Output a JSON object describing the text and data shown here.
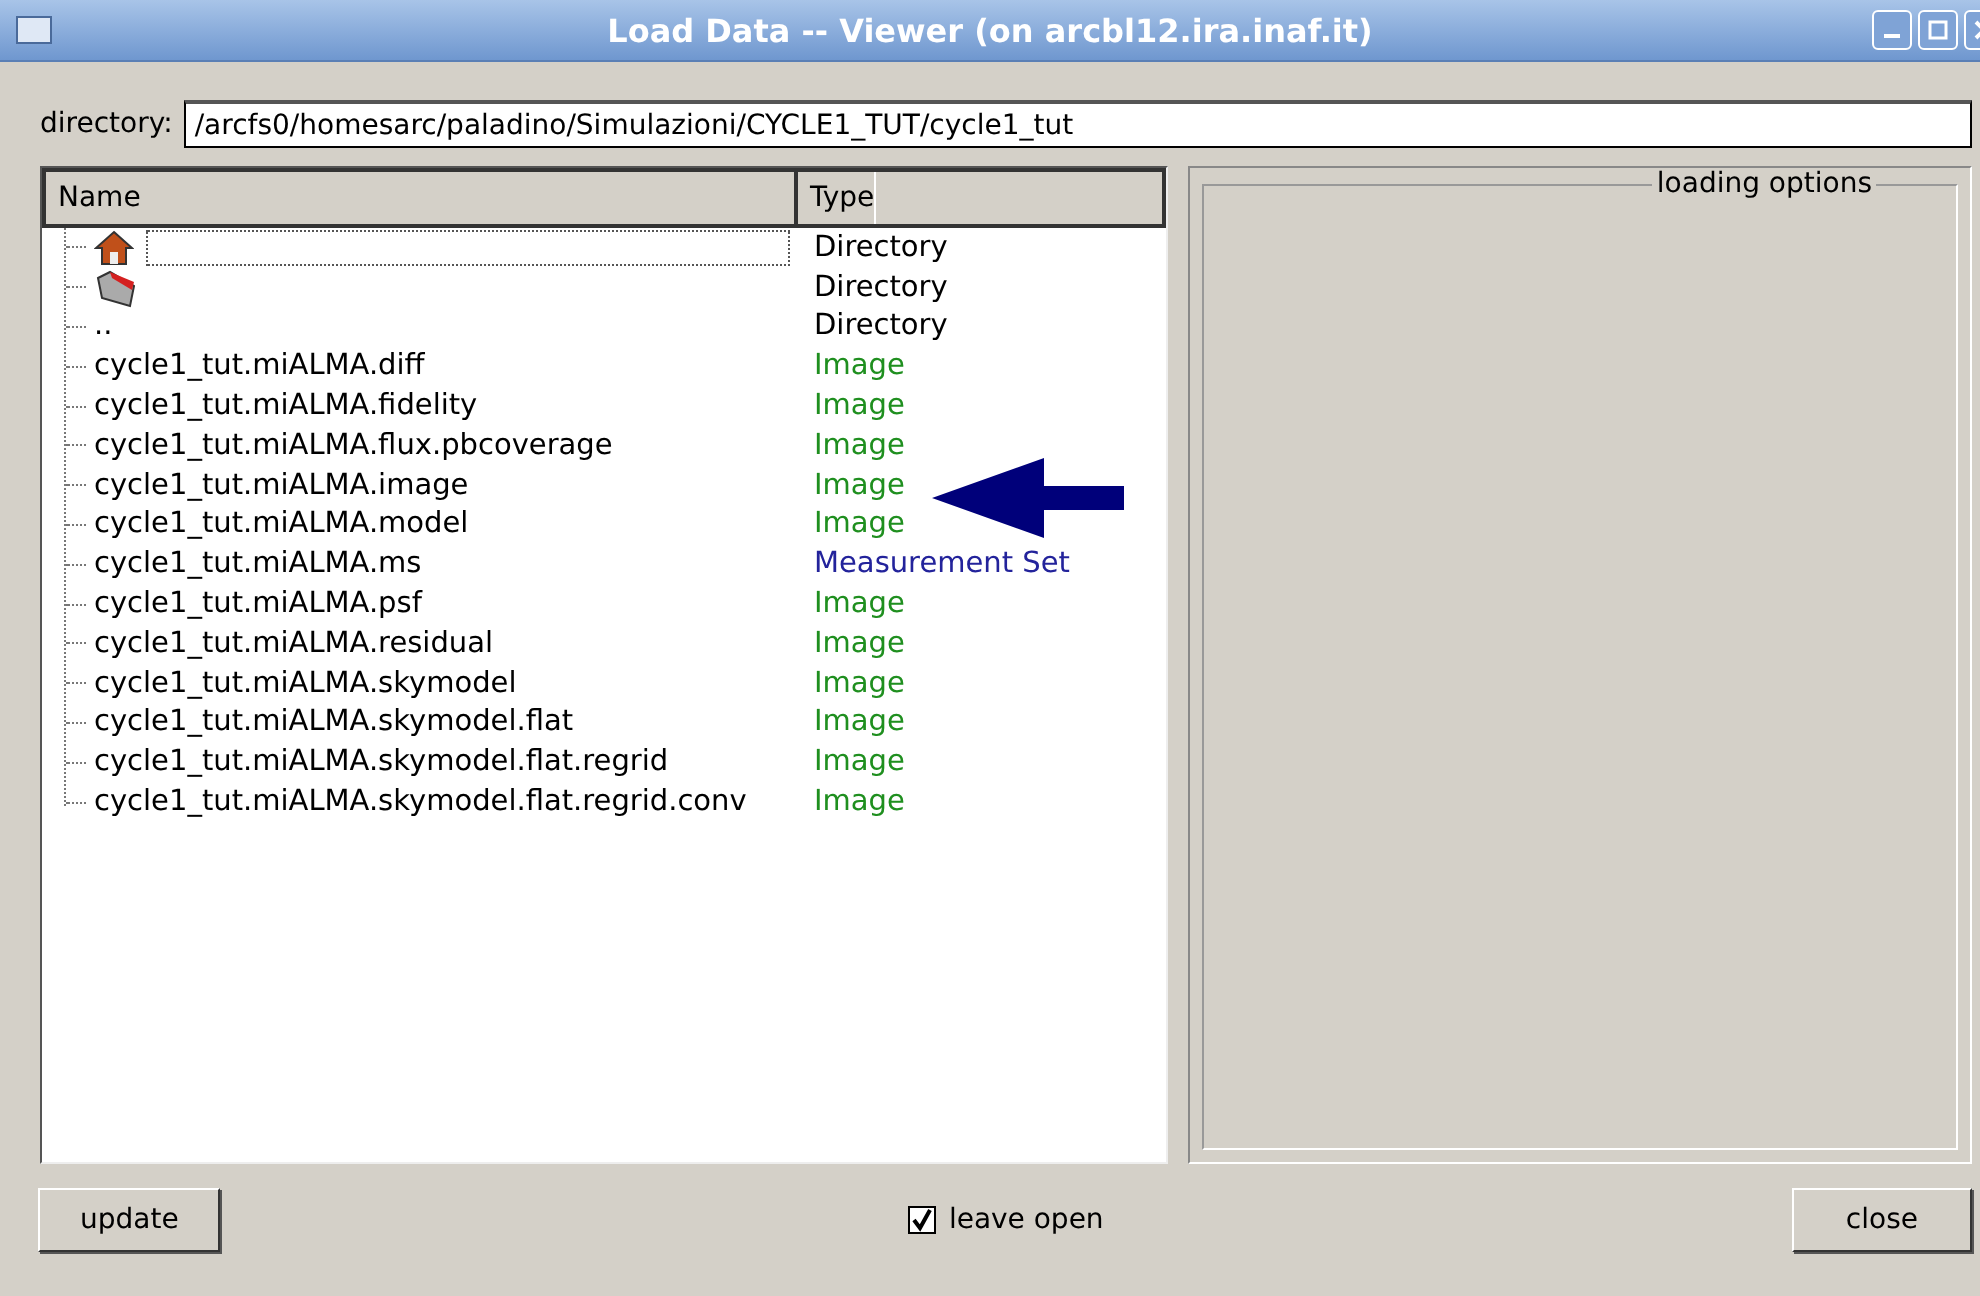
{
  "window": {
    "title": "Load Data -- Viewer (on arcbl12.ira.inaf.it)"
  },
  "directory": {
    "label": "directory:",
    "value": "/arcfs0/homesarc/paladino/Simulazioni/CYCLE1_TUT/cycle1_tut"
  },
  "table": {
    "columns": [
      "Name",
      "Type"
    ],
    "rows": [
      {
        "kind": "home",
        "name": "",
        "type": "Directory",
        "color": "#000000",
        "focused": true
      },
      {
        "kind": "folder",
        "name": "",
        "type": "Directory",
        "color": "#000000",
        "focused": false
      },
      {
        "kind": "text",
        "name": "..",
        "type": "Directory",
        "color": "#000000",
        "focused": false
      },
      {
        "kind": "text",
        "name": "cycle1_tut.miALMA.diff",
        "type": "Image",
        "color": "#1f8f1f",
        "focused": false
      },
      {
        "kind": "text",
        "name": "cycle1_tut.miALMA.fidelity",
        "type": "Image",
        "color": "#1f8f1f",
        "focused": false
      },
      {
        "kind": "text",
        "name": "cycle1_tut.miALMA.flux.pbcoverage",
        "type": "Image",
        "color": "#1f8f1f",
        "focused": false
      },
      {
        "kind": "text",
        "name": "cycle1_tut.miALMA.image",
        "type": "Image",
        "color": "#1f8f1f",
        "focused": false
      },
      {
        "kind": "text",
        "name": "cycle1_tut.miALMA.model",
        "type": "Image",
        "color": "#1f8f1f",
        "focused": false
      },
      {
        "kind": "text",
        "name": "cycle1_tut.miALMA.ms",
        "type": "Measurement Set",
        "color": "#23239b",
        "focused": false
      },
      {
        "kind": "text",
        "name": "cycle1_tut.miALMA.psf",
        "type": "Image",
        "color": "#1f8f1f",
        "focused": false
      },
      {
        "kind": "text",
        "name": "cycle1_tut.miALMA.residual",
        "type": "Image",
        "color": "#1f8f1f",
        "focused": false
      },
      {
        "kind": "text",
        "name": "cycle1_tut.miALMA.skymodel",
        "type": "Image",
        "color": "#1f8f1f",
        "focused": false
      },
      {
        "kind": "text",
        "name": "cycle1_tut.miALMA.skymodel.flat",
        "type": "Image",
        "color": "#1f8f1f",
        "focused": false
      },
      {
        "kind": "text",
        "name": "cycle1_tut.miALMA.skymodel.flat.regrid",
        "type": "Image",
        "color": "#1f8f1f",
        "focused": false
      },
      {
        "kind": "text",
        "name": "cycle1_tut.miALMA.skymodel.flat.regrid.conv",
        "type": "Image",
        "color": "#1f8f1f",
        "focused": false
      }
    ]
  },
  "options_panel": {
    "title": "loading options"
  },
  "buttons": {
    "update": "update",
    "close": "close"
  },
  "leave_open": {
    "label": "leave open",
    "checked": true
  }
}
